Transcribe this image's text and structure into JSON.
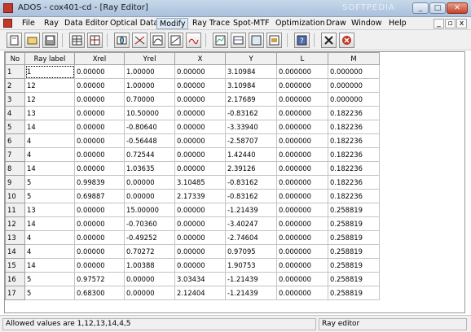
{
  "window": {
    "title": "ADOS - cox401-cd - [Ray Editor]",
    "watermark": "SOFTPEDIA",
    "controls": {
      "minimize": "_",
      "maximize": "□",
      "close": "✕"
    }
  },
  "menu": {
    "items": [
      "File",
      "Ray",
      "Data Editor",
      "Optical Data",
      "Modify",
      "Ray Trace",
      "Spot-MTF",
      "Optimization",
      "Draw",
      "Window",
      "Help"
    ],
    "active": "Modify",
    "mdi_controls": {
      "minimize": "_",
      "restore": "▫",
      "close": "x"
    }
  },
  "toolbar": {
    "icons": [
      "new-file-icon",
      "open-folder-icon",
      "save-icon",
      "insert-row-icon",
      "delete-row-icon",
      "lens-icon",
      "ray-plot-icon",
      "spot-diagram-icon",
      "aberration-icon",
      "mtf-icon",
      "graph-icon",
      "layout-icon",
      "surface-icon",
      "optimize-icon",
      "help-icon",
      "close-icon",
      "cancel-icon"
    ]
  },
  "grid": {
    "columns": [
      "No",
      "Ray label",
      "Xrel",
      "Yrel",
      "X",
      "Y",
      "L",
      "M"
    ],
    "rows": [
      [
        "1",
        "1",
        "0.00000",
        "1.00000",
        "0.00000",
        "3.10984",
        "0.000000",
        "0.000000"
      ],
      [
        "2",
        "12",
        "0.00000",
        "1.00000",
        "0.00000",
        "3.10984",
        "0.000000",
        "0.000000"
      ],
      [
        "3",
        "12",
        "0.00000",
        "0.70000",
        "0.00000",
        "2.17689",
        "0.000000",
        "0.000000"
      ],
      [
        "4",
        "13",
        "0.00000",
        "10.50000",
        "0.00000",
        "-0.83162",
        "0.000000",
        "0.182236"
      ],
      [
        "5",
        "14",
        "0.00000",
        "-0.80640",
        "0.00000",
        "-3.33940",
        "0.000000",
        "0.182236"
      ],
      [
        "6",
        "4",
        "0.00000",
        "-0.56448",
        "0.00000",
        "-2.58707",
        "0.000000",
        "0.182236"
      ],
      [
        "7",
        "4",
        "0.00000",
        "0.72544",
        "0.00000",
        "1.42440",
        "0.000000",
        "0.182236"
      ],
      [
        "8",
        "14",
        "0.00000",
        "1.03635",
        "0.00000",
        "2.39126",
        "0.000000",
        "0.182236"
      ],
      [
        "9",
        "5",
        "0.99839",
        "0.00000",
        "3.10485",
        "-0.83162",
        "0.000000",
        "0.182236"
      ],
      [
        "10",
        "5",
        "0.69887",
        "0.00000",
        "2.17339",
        "-0.83162",
        "0.000000",
        "0.182236"
      ],
      [
        "11",
        "13",
        "0.00000",
        "15.00000",
        "0.00000",
        "-1.21439",
        "0.000000",
        "0.258819"
      ],
      [
        "12",
        "14",
        "0.00000",
        "-0.70360",
        "0.00000",
        "-3.40247",
        "0.000000",
        "0.258819"
      ],
      [
        "13",
        "4",
        "0.00000",
        "-0.49252",
        "0.00000",
        "-2.74604",
        "0.000000",
        "0.258819"
      ],
      [
        "14",
        "4",
        "0.00000",
        "0.70272",
        "0.00000",
        "0.97095",
        "0.000000",
        "0.258819"
      ],
      [
        "15",
        "14",
        "0.00000",
        "1.00388",
        "0.00000",
        "1.90753",
        "0.000000",
        "0.258819"
      ],
      [
        "16",
        "5",
        "0.97572",
        "0.00000",
        "3.03434",
        "-1.21439",
        "0.000000",
        "0.258819"
      ],
      [
        "17",
        "5",
        "0.68300",
        "0.00000",
        "2.12404",
        "-1.21439",
        "0.000000",
        "0.258819"
      ]
    ]
  },
  "status": {
    "message": "Allowed values are 1,12,13,14,4,5",
    "mode": "Ray editor"
  }
}
